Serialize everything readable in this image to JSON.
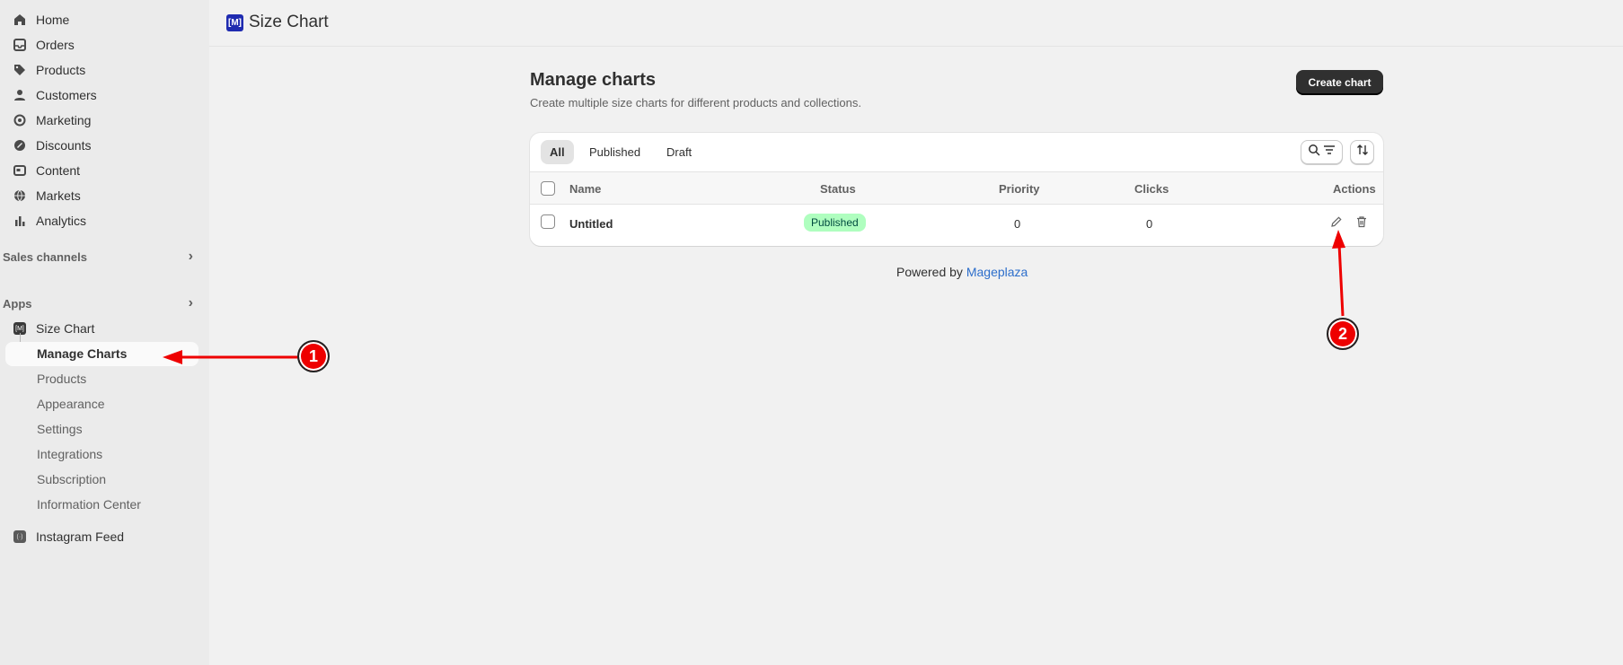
{
  "sidebar": {
    "items": [
      {
        "label": "Home",
        "icon": "home-icon"
      },
      {
        "label": "Orders",
        "icon": "inbox-icon"
      },
      {
        "label": "Products",
        "icon": "tag-icon"
      },
      {
        "label": "Customers",
        "icon": "person-icon"
      },
      {
        "label": "Marketing",
        "icon": "target-icon"
      },
      {
        "label": "Discounts",
        "icon": "discount-icon"
      },
      {
        "label": "Content",
        "icon": "content-icon"
      },
      {
        "label": "Markets",
        "icon": "globe-icon"
      },
      {
        "label": "Analytics",
        "icon": "bar-chart-icon"
      }
    ],
    "sales_channels": "Sales channels",
    "apps": "Apps",
    "app_size_chart": "Size Chart",
    "sub_items": [
      "Manage Charts",
      "Products",
      "Appearance",
      "Settings",
      "Integrations",
      "Subscription",
      "Information Center"
    ],
    "app_instagram": "Instagram Feed"
  },
  "topbar": {
    "title": "Size Chart",
    "logo_text": "[M]"
  },
  "main": {
    "title": "Manage charts",
    "subtitle": "Create multiple size charts for different products and collections.",
    "create_button": "Create chart",
    "tabs": [
      "All",
      "Published",
      "Draft"
    ],
    "columns": {
      "name": "Name",
      "status": "Status",
      "priority": "Priority",
      "clicks": "Clicks",
      "actions": "Actions"
    },
    "rows": [
      {
        "name": "Untitled",
        "status": "Published",
        "priority": "0",
        "clicks": "0"
      }
    ],
    "powered_by": "Powered by",
    "powered_link": "Mageplaza"
  },
  "annotations": {
    "one": "1",
    "two": "2"
  },
  "colors": {
    "accent": "#303030",
    "badge_bg": "#affebf",
    "link": "#2c6ecb",
    "annotation": "#ee0000"
  }
}
